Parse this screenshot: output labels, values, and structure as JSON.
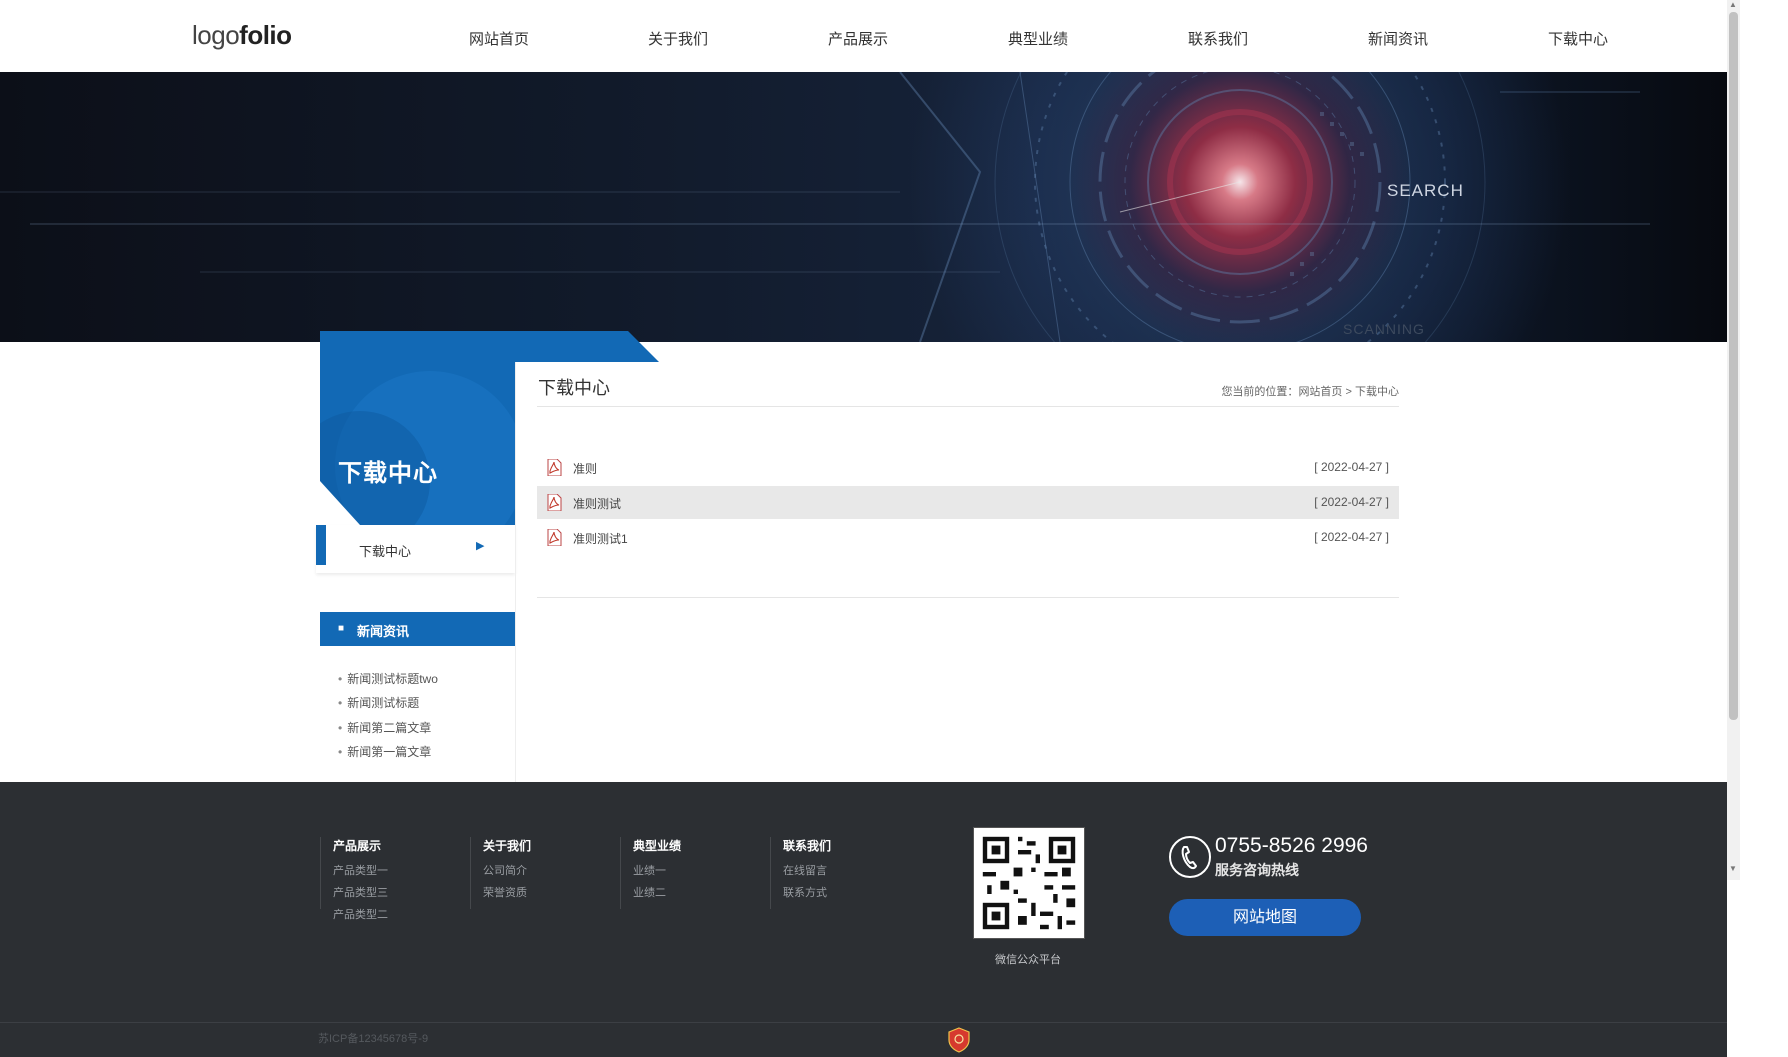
{
  "header": {
    "logo_light": "logo",
    "logo_bold": "folio",
    "nav": [
      "网站首页",
      "关于我们",
      "产品展示",
      "典型业绩",
      "联系我们",
      "新闻资讯",
      "下载中心"
    ]
  },
  "banner": {
    "word_search": "SEARCH",
    "word_scanning": "SCANNING"
  },
  "sidebar": {
    "title": "下载中心",
    "sub_item": "下载中心",
    "news_title": "新闻资讯",
    "news": [
      "新闻测试标题two",
      "新闻测试标题",
      "新闻第二篇文章",
      "新闻第一篇文章"
    ]
  },
  "main": {
    "title": "下载中心",
    "breadcrumb_prefix": "您当前的位置：",
    "breadcrumb_home": "网站首页",
    "breadcrumb_sep": ">",
    "breadcrumb_current": "下载中心",
    "downloads": [
      {
        "name": "准则",
        "date": "[ 2022-04-27 ]"
      },
      {
        "name": "准则测试",
        "date": "[ 2022-04-27 ]"
      },
      {
        "name": "准则测试1",
        "date": "[ 2022-04-27 ]"
      }
    ]
  },
  "footer": {
    "columns": [
      {
        "title": "产品展示",
        "links": [
          "产品类型一",
          "产品类型三",
          "产品类型二"
        ]
      },
      {
        "title": "关于我们",
        "links": [
          "公司简介",
          "荣誉资质"
        ]
      },
      {
        "title": "典型业绩",
        "links": [
          "业绩一",
          "业绩二"
        ]
      },
      {
        "title": "联系我们",
        "links": [
          "在线留言",
          "联系方式"
        ]
      }
    ],
    "qr_caption": "微信公众平台",
    "phone": "0755-8526 2996",
    "phone_caption": "服务咨询热线",
    "sitemap": "网站地图",
    "icp": "苏ICP备12345678号-9"
  },
  "colors": {
    "brand_blue": "#1269b5",
    "footer_bg": "#2c2f33",
    "button_blue": "#1d5fb6"
  }
}
